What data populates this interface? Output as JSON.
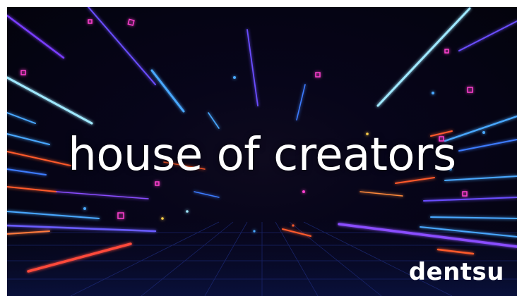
{
  "headline": "house of creators",
  "brand": {
    "logo_text": "dentsu"
  },
  "colors": {
    "background": "#050414",
    "neon_blue": "#4aa8ff",
    "neon_cyan": "#9fe8ff",
    "neon_purple": "#8a4dff",
    "neon_pink": "#ff3fd0",
    "neon_orange": "#ff5a2a",
    "text": "#ffffff"
  }
}
